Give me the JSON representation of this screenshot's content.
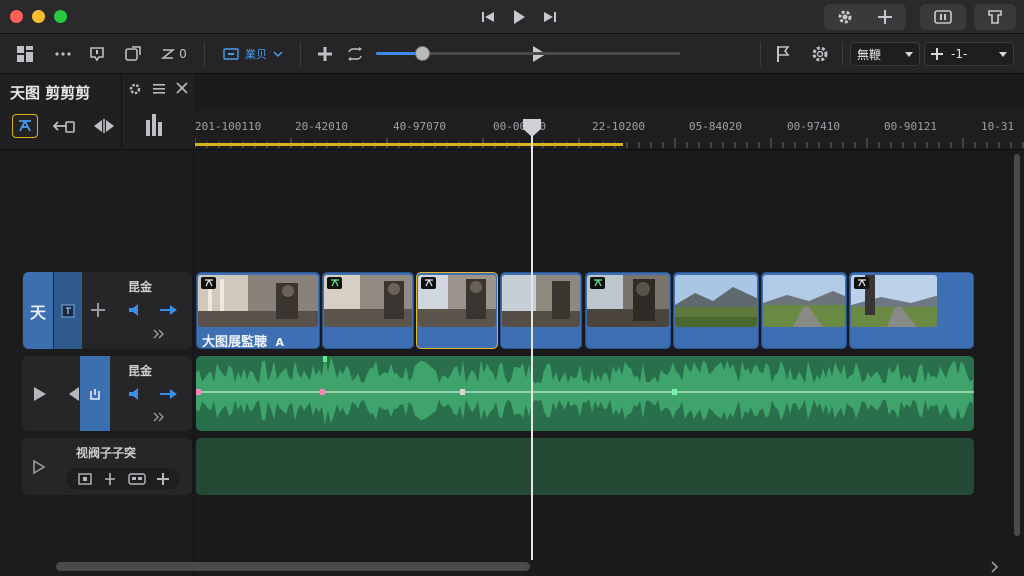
{
  "panel": {
    "title": "天图 剪剪剪"
  },
  "toolbar": {
    "counter": "0",
    "view_dropdown": "業贝",
    "zoom_fraction": 0.15,
    "preset_dropdown": "無鞭",
    "speed_label": "-1-"
  },
  "ruler": {
    "ticks": [
      "201-100110",
      "20-42010",
      "40-97070",
      "00-00000",
      "22-10200",
      "05-84020",
      "00-97410",
      "00-90121",
      "10-31"
    ]
  },
  "tracks": {
    "video": {
      "icon_label": "天",
      "title": "昆金",
      "clip_title": "大图展監聴",
      "clip_marker": "A"
    },
    "audio": {
      "title": "昆金"
    },
    "third": {
      "title": "视阀子子突"
    }
  },
  "colors": {
    "accent": "#3b8ee8",
    "video_clip": "#3f6fb3",
    "audio_clip": "#2a6f4c",
    "selection": "#d8b41c"
  }
}
